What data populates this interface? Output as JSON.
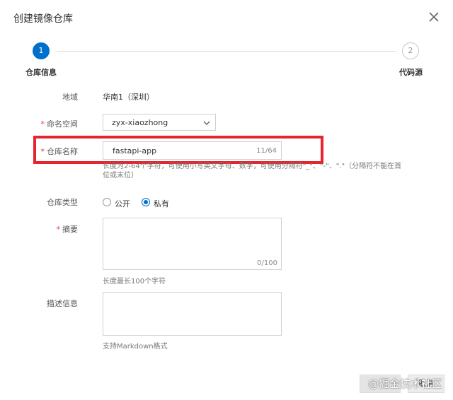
{
  "dialog": {
    "title": "创建镜像仓库",
    "close_icon": "close-icon"
  },
  "steps": [
    {
      "number": "1",
      "label": "仓库信息",
      "active": true,
      "color": "#0070cc"
    },
    {
      "number": "2",
      "label": "代码源",
      "active": false
    }
  ],
  "form": {
    "region": {
      "label": "地域",
      "value": "华南1（深圳）"
    },
    "namespace": {
      "label": "命名空间",
      "required": true,
      "value": "zyx-xiaozhong"
    },
    "repo_name": {
      "label": "仓库名称",
      "required": true,
      "value": "fastapi-app",
      "counter": "11/64",
      "help": "长度为2-64个字符，可使用小写英文字母、数字，可使用分隔符\"_\"、\"-\"、\".\"（分隔符不能在首位或末位）"
    },
    "repo_type": {
      "label": "仓库类型",
      "options": [
        {
          "label": "公开",
          "selected": false
        },
        {
          "label": "私有",
          "selected": true
        }
      ]
    },
    "summary": {
      "label": "摘要",
      "required": true,
      "value": "",
      "counter": "0/100",
      "note": "长度最长100个字符"
    },
    "description": {
      "label": "描述信息",
      "value": "",
      "note": "支持Markdown格式"
    }
  },
  "footer": {
    "cancel_label": "取消"
  },
  "watermark": "@掘金技术社区",
  "highlight_color": "#e5262e"
}
